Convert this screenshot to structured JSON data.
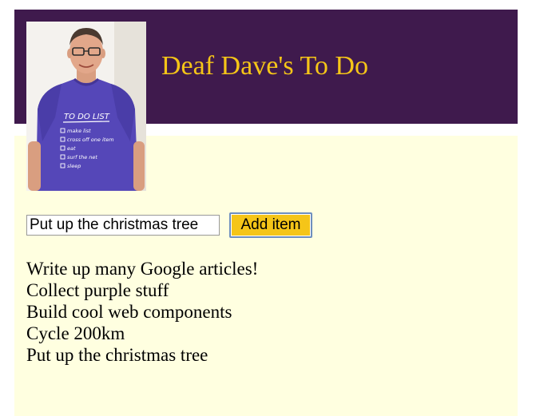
{
  "header": {
    "title": "Deaf Dave's To Do",
    "background": "#3f1a4d",
    "title_color": "#f5c518"
  },
  "avatar": {
    "shirt_lettering": "TO DO LIST",
    "shirt_items": [
      "make list",
      "cross off one item",
      "eat",
      "surf the net",
      "sleep"
    ]
  },
  "form": {
    "input_value": "Put up the christmas tree",
    "add_label": "Add item",
    "button_color": "#f5c518"
  },
  "todos": [
    "Write up many Google articles!",
    "Collect purple stuff",
    "Build cool web components",
    "Cycle 200km",
    "Put up the christmas tree"
  ],
  "main": {
    "background": "#ffffe0"
  }
}
